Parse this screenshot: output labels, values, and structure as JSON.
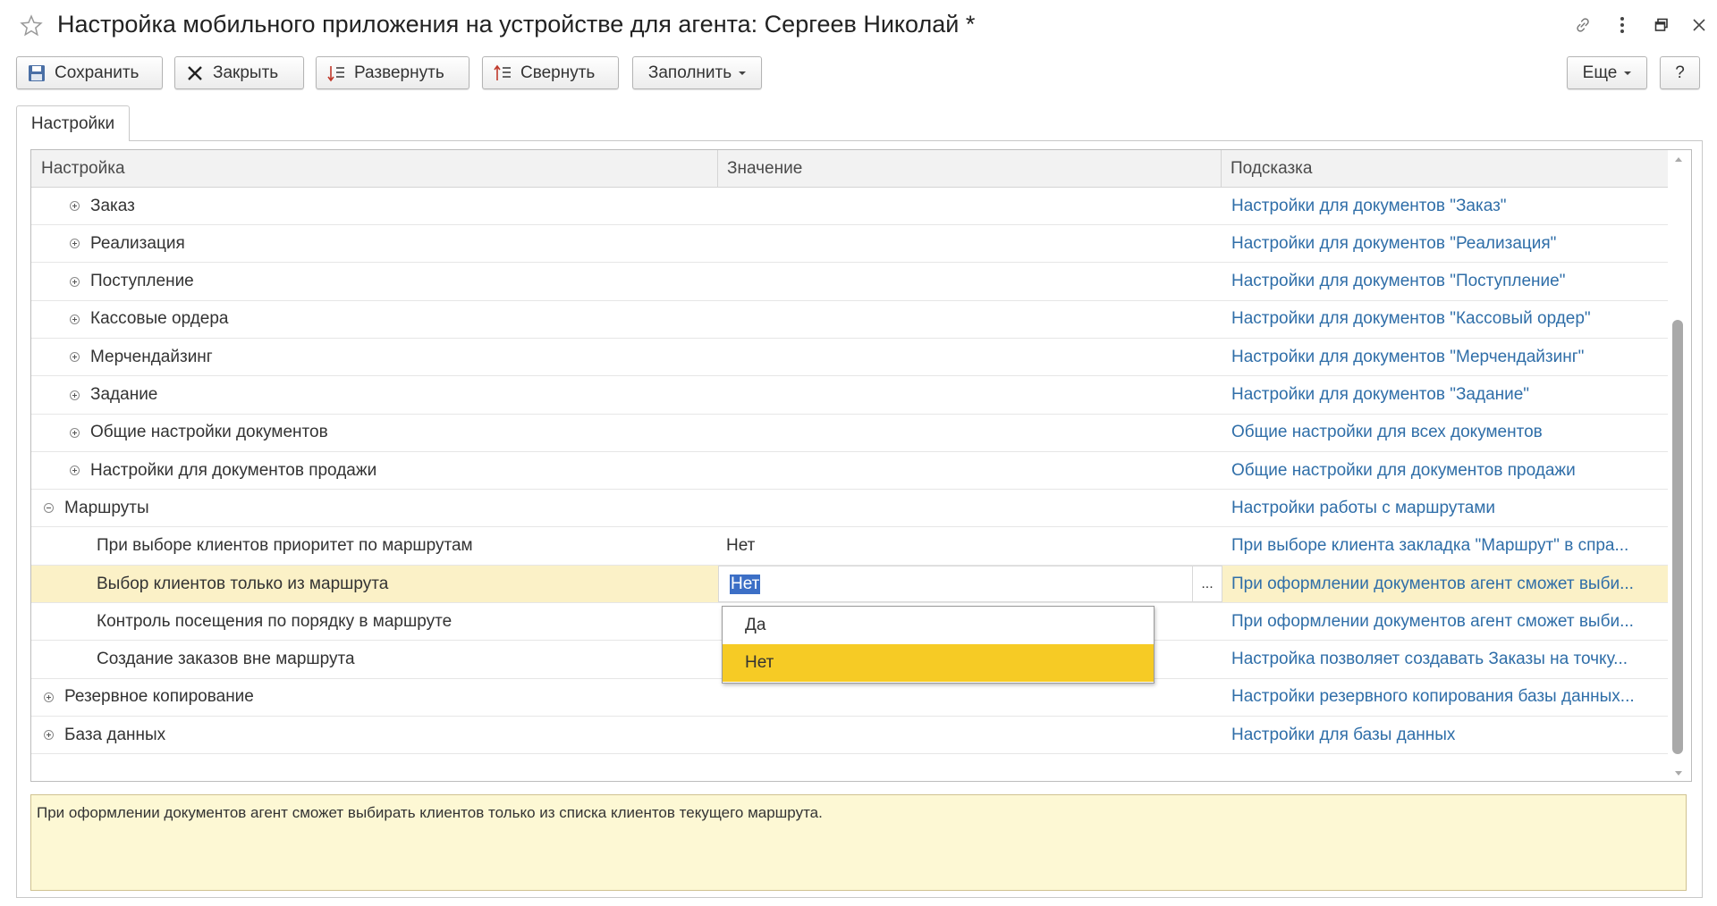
{
  "window": {
    "title": "Настройка мобильного приложения на устройстве для агента: Сергеев Николай *"
  },
  "toolbar": {
    "save_label": "Сохранить",
    "close_label": "Закрыть",
    "expand_label": "Развернуть",
    "collapse_label": "Свернуть",
    "fill_label": "Заполнить",
    "more_label": "Еще",
    "help_label": "?"
  },
  "tabs": [
    {
      "label": "Настройки",
      "active": true
    }
  ],
  "grid": {
    "columns": [
      "Настройка",
      "Значение",
      "Подсказка"
    ],
    "rows": [
      {
        "name": "Заказ",
        "level": 1,
        "node": "collapsed",
        "value": "",
        "hint": "Настройки для документов \"Заказ\""
      },
      {
        "name": "Реализация",
        "level": 1,
        "node": "collapsed",
        "value": "",
        "hint": "Настройки для документов \"Реализация\""
      },
      {
        "name": "Поступление",
        "level": 1,
        "node": "collapsed",
        "value": "",
        "hint": "Настройки для документов \"Поступление\""
      },
      {
        "name": "Кассовые ордера",
        "level": 1,
        "node": "collapsed",
        "value": "",
        "hint": "Настройки для документов \"Кассовый ордер\""
      },
      {
        "name": "Мерчендайзинг",
        "level": 1,
        "node": "collapsed",
        "value": "",
        "hint": "Настройки для документов \"Мерчендайзинг\""
      },
      {
        "name": "Задание",
        "level": 1,
        "node": "collapsed",
        "value": "",
        "hint": "Настройки для документов \"Задание\""
      },
      {
        "name": "Общие настройки документов",
        "level": 1,
        "node": "collapsed",
        "value": "",
        "hint": "Общие настройки для всех документов"
      },
      {
        "name": "Настройки для документов продажи",
        "level": 1,
        "node": "collapsed",
        "value": "",
        "hint": "Общие настройки для документов продажи"
      },
      {
        "name": "Маршруты",
        "level": 0,
        "node": "expanded",
        "value": "",
        "hint": "Настройки работы с маршрутами"
      },
      {
        "name": "При выборе клиентов приоритет по маршрутам",
        "level": 2,
        "node": "leaf",
        "value": "Нет",
        "hint": "При выборе клиента закладка \"Маршрут\" в спра..."
      },
      {
        "name": "Выбор клиентов только из маршрута",
        "level": 2,
        "node": "leaf",
        "value": "Нет",
        "hint": "При оформлении документов агент сможет выби...",
        "selected": true,
        "editing": true
      },
      {
        "name": "Контроль посещения по порядку в маршруте",
        "level": 2,
        "node": "leaf",
        "value": "",
        "hint": "При оформлении документов агент сможет выби..."
      },
      {
        "name": "Создание заказов вне маршрута",
        "level": 2,
        "node": "leaf",
        "value": "",
        "hint": "Настройка позволяет создавать Заказы на точку..."
      },
      {
        "name": "Резервное копирование",
        "level": 0,
        "node": "collapsed",
        "value": "",
        "hint": "Настройки резервного копирования базы данных..."
      },
      {
        "name": "База данных",
        "level": 0,
        "node": "collapsed",
        "value": "",
        "hint": "Настройки для базы данных"
      }
    ]
  },
  "editor": {
    "value": "Нет",
    "button_label": "..."
  },
  "dropdown": {
    "options": [
      "Да",
      "Нет"
    ],
    "selected": "Нет"
  },
  "info_panel": {
    "text": "При оформлении документов агент сможет выбирать клиентов только из списка клиентов текущего маршрута."
  }
}
